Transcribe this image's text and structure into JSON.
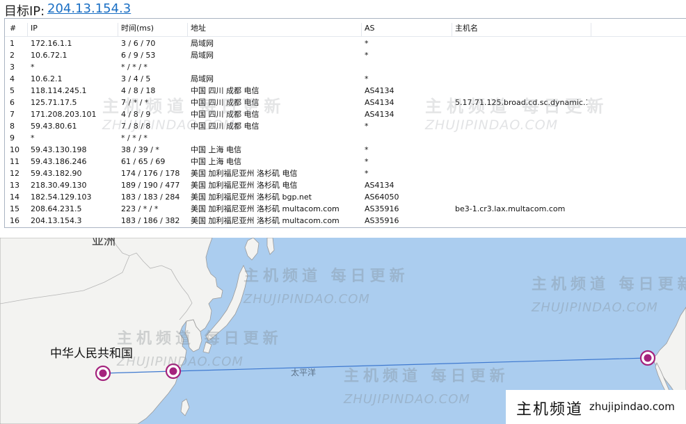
{
  "target": {
    "label": "目标IP:",
    "ip": "204.13.154.3"
  },
  "table": {
    "headers": [
      "#",
      "IP",
      "时间(ms)",
      "地址",
      "AS",
      "主机名"
    ],
    "rows": [
      [
        "1",
        "172.16.1.1",
        "3 / 6 / 70",
        "局域网",
        "*",
        ""
      ],
      [
        "2",
        "10.6.72.1",
        "6 / 9 / 53",
        "局域网",
        "*",
        ""
      ],
      [
        "3",
        "*",
        "* / * / *",
        "",
        "",
        ""
      ],
      [
        "4",
        "10.6.2.1",
        "3 / 4 / 5",
        "局域网",
        "*",
        ""
      ],
      [
        "5",
        "118.114.245.1",
        "4 / 8 / 18",
        "中国 四川 成都 电信",
        "AS4134",
        ""
      ],
      [
        "6",
        "125.71.17.5",
        "7 / * / *",
        "中国 四川 成都 电信",
        "AS4134",
        "5.17.71.125.broad.cd.sc.dynamic.1..."
      ],
      [
        "7",
        "171.208.203.101",
        "4 / 8 / 9",
        "中国 四川 成都 电信",
        "AS4134",
        ""
      ],
      [
        "8",
        "59.43.80.61",
        "7 / 8 / 8",
        "中国 四川 成都 电信",
        "*",
        ""
      ],
      [
        "9",
        "*",
        "* / * / *",
        "",
        "",
        ""
      ],
      [
        "10",
        "59.43.130.198",
        "38 / 39 / *",
        "中国 上海 电信",
        "*",
        ""
      ],
      [
        "11",
        "59.43.186.246",
        "61 / 65 / 69",
        "中国 上海 电信",
        "*",
        ""
      ],
      [
        "12",
        "59.43.182.90",
        "174 / 176 / 178",
        "美国 加利福尼亚州 洛杉矶 电信",
        "*",
        ""
      ],
      [
        "13",
        "218.30.49.130",
        "189 / 190 / 477",
        "美国 加利福尼亚州 洛杉矶 电信",
        "AS4134",
        ""
      ],
      [
        "14",
        "182.54.129.103",
        "183 / 183 / 284",
        "美国 加利福尼亚州 洛杉矶 bgp.net",
        "AS64050",
        ""
      ],
      [
        "15",
        "208.64.231.5",
        "223 / * / *",
        "美国 加利福尼亚州 洛杉矶 multacom.com",
        "AS35916",
        "be3-1.cr3.lax.multacom.com"
      ],
      [
        "16",
        "204.13.154.3",
        "183 / 186 / 382",
        "美国 加利福尼亚州 洛杉矶 multacom.com",
        "AS35916",
        ""
      ]
    ]
  },
  "map": {
    "country_label": "中华人民共和国",
    "top_label": "亚洲",
    "ocean_label": "太平洋",
    "colors": {
      "water": "#abcdef",
      "land": "#f3f3f1",
      "route": "#3d78cf",
      "marker": "#a4237d"
    }
  },
  "watermark": {
    "cn": "主机频道 每日更新",
    "en": "ZHUJIPINDAO.COM"
  },
  "brand": {
    "cn": "主机频道",
    "en": "zhujipindao.com"
  }
}
